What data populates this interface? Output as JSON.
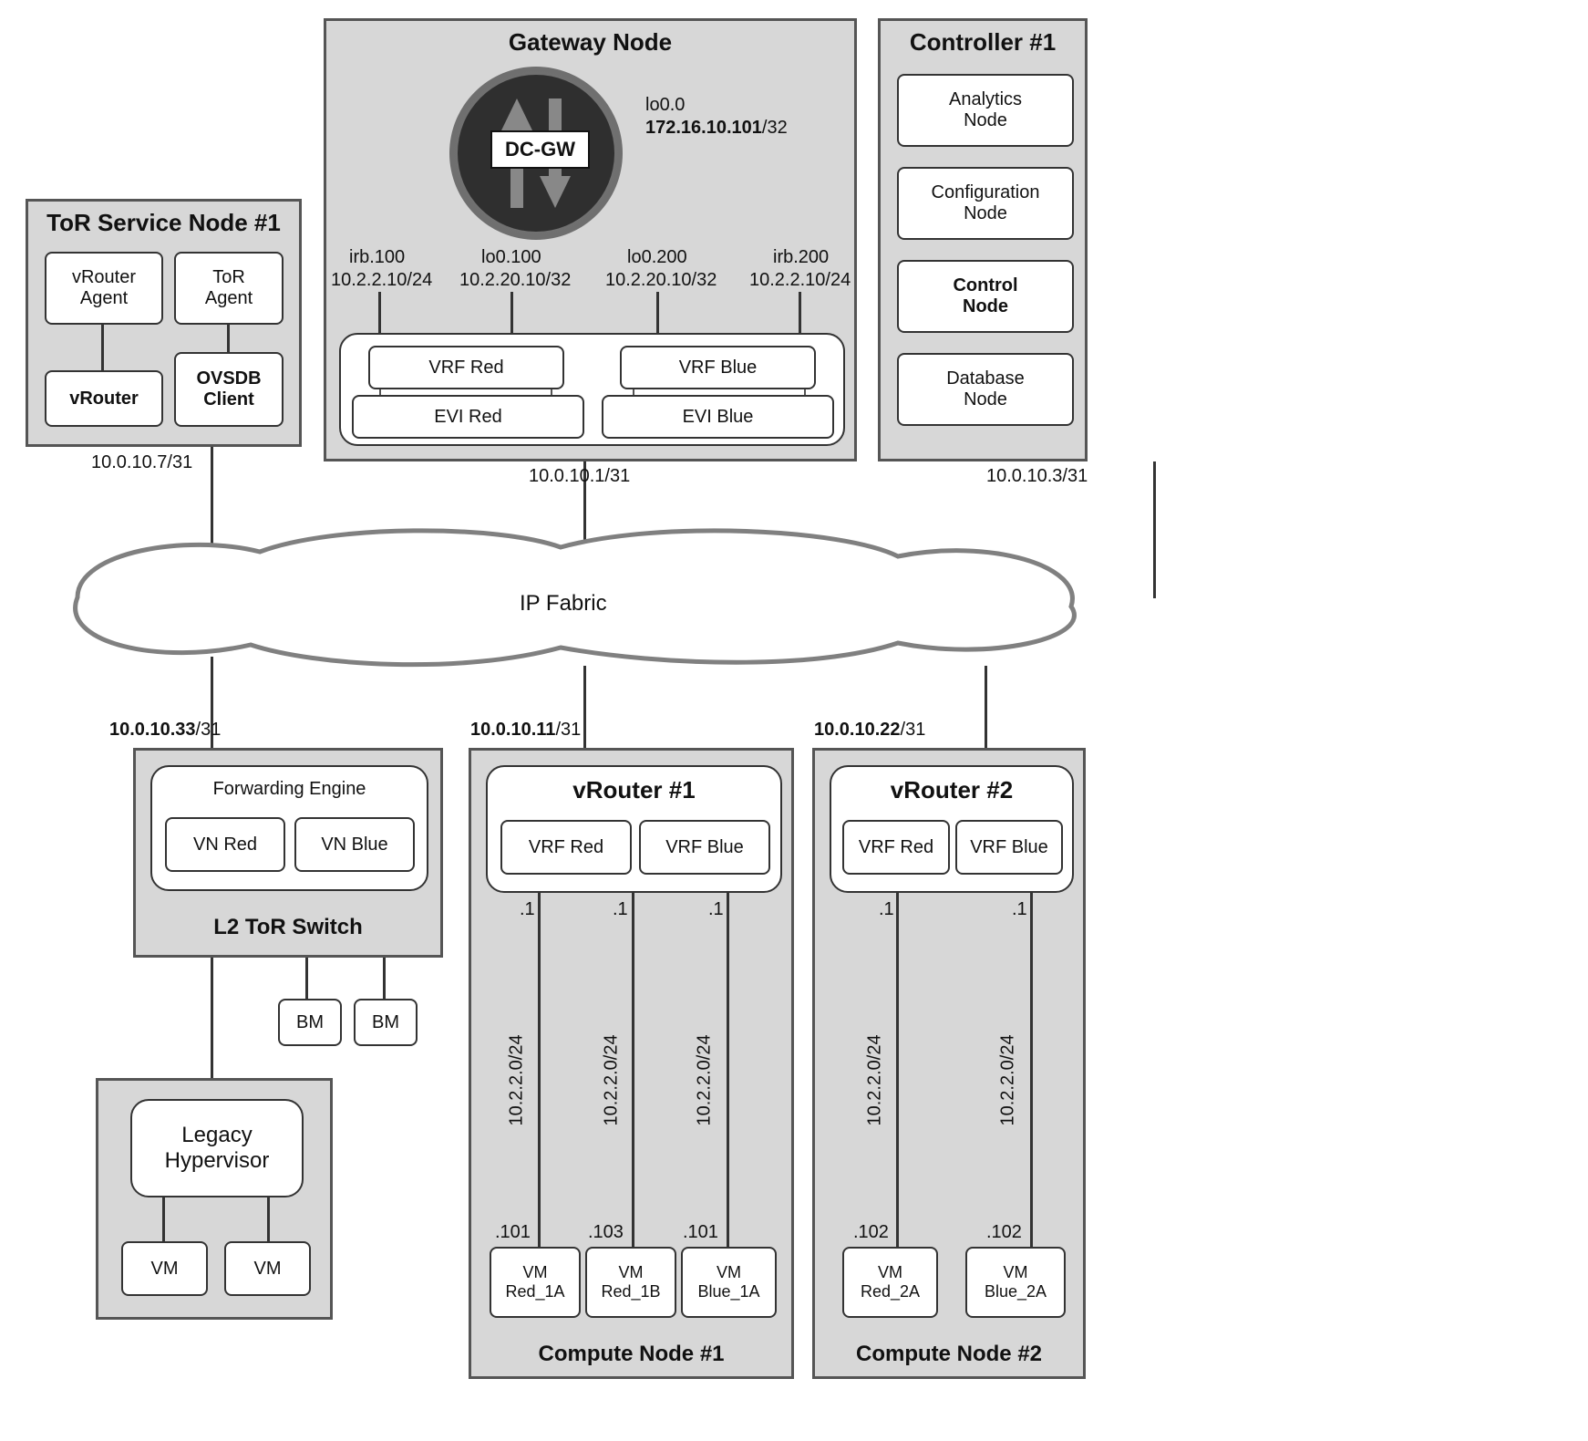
{
  "tor_service": {
    "title": "ToR Service Node #1",
    "vrouter_agent": "vRouter\nAgent",
    "tor_agent": "ToR\nAgent",
    "vrouter": "vRouter",
    "ovsdb_client": "OVSDB\nClient",
    "ip": "10.0.10.7/31"
  },
  "gateway": {
    "title": "Gateway Node",
    "dcgw": "DC-GW",
    "lo_label": "lo0.0",
    "lo_ip_bold": "172.16.10.101",
    "lo_ip_suffix": "/32",
    "irb100": {
      "name": "irb.100",
      "ip": "10.2.2.10/24"
    },
    "lo100": {
      "name": "lo0.100",
      "ip": "10.2.20.10/32"
    },
    "lo200": {
      "name": "lo0.200",
      "ip": "10.2.20.10/32"
    },
    "irb200": {
      "name": "irb.200",
      "ip": "10.2.2.10/24"
    },
    "vrf_red": "VRF Red",
    "vrf_blue": "VRF Blue",
    "evi_red": "EVI Red",
    "evi_blue": "EVI Blue",
    "ip": "10.0.10.1/31"
  },
  "controller": {
    "title": "Controller #1",
    "analytics": "Analytics\nNode",
    "configuration": "Configuration\nNode",
    "control": "Control\nNode",
    "database": "Database\nNode",
    "ip": "10.0.10.3/31"
  },
  "fabric": {
    "label": "IP Fabric"
  },
  "tor_switch": {
    "ip_bold": "10.0.10.33",
    "ip_suffix": "/31",
    "forwarding_engine": "Forwarding Engine",
    "vn_red": "VN Red",
    "vn_blue": "VN Blue",
    "title": "L2 ToR Switch",
    "bm": "BM",
    "legacy": "Legacy\nHypervisor",
    "vm": "VM"
  },
  "compute1": {
    "ip_bold": "10.0.10.11",
    "ip_suffix": "/31",
    "vrouter": "vRouter #1",
    "vrf_red": "VRF Red",
    "vrf_blue": "VRF Blue",
    "subnet": "10.2.2.0/24",
    "gw_ip": ".1",
    "vm1": {
      "name": "VM\nRed_1A",
      "ip": ".101"
    },
    "vm2": {
      "name": "VM\nRed_1B",
      "ip": ".103"
    },
    "vm3": {
      "name": "VM\nBlue_1A",
      "ip": ".101"
    },
    "title": "Compute Node #1"
  },
  "compute2": {
    "ip_bold": "10.0.10.22",
    "ip_suffix": "/31",
    "vrouter": "vRouter #2",
    "vrf_red": "VRF Red",
    "vrf_blue": "VRF Blue",
    "subnet": "10.2.2.0/24",
    "gw_ip": ".1",
    "vm1": {
      "name": "VM\nRed_2A",
      "ip": ".102"
    },
    "vm2": {
      "name": "VM\nBlue_2A",
      "ip": ".102"
    },
    "title": "Compute Node #2"
  }
}
